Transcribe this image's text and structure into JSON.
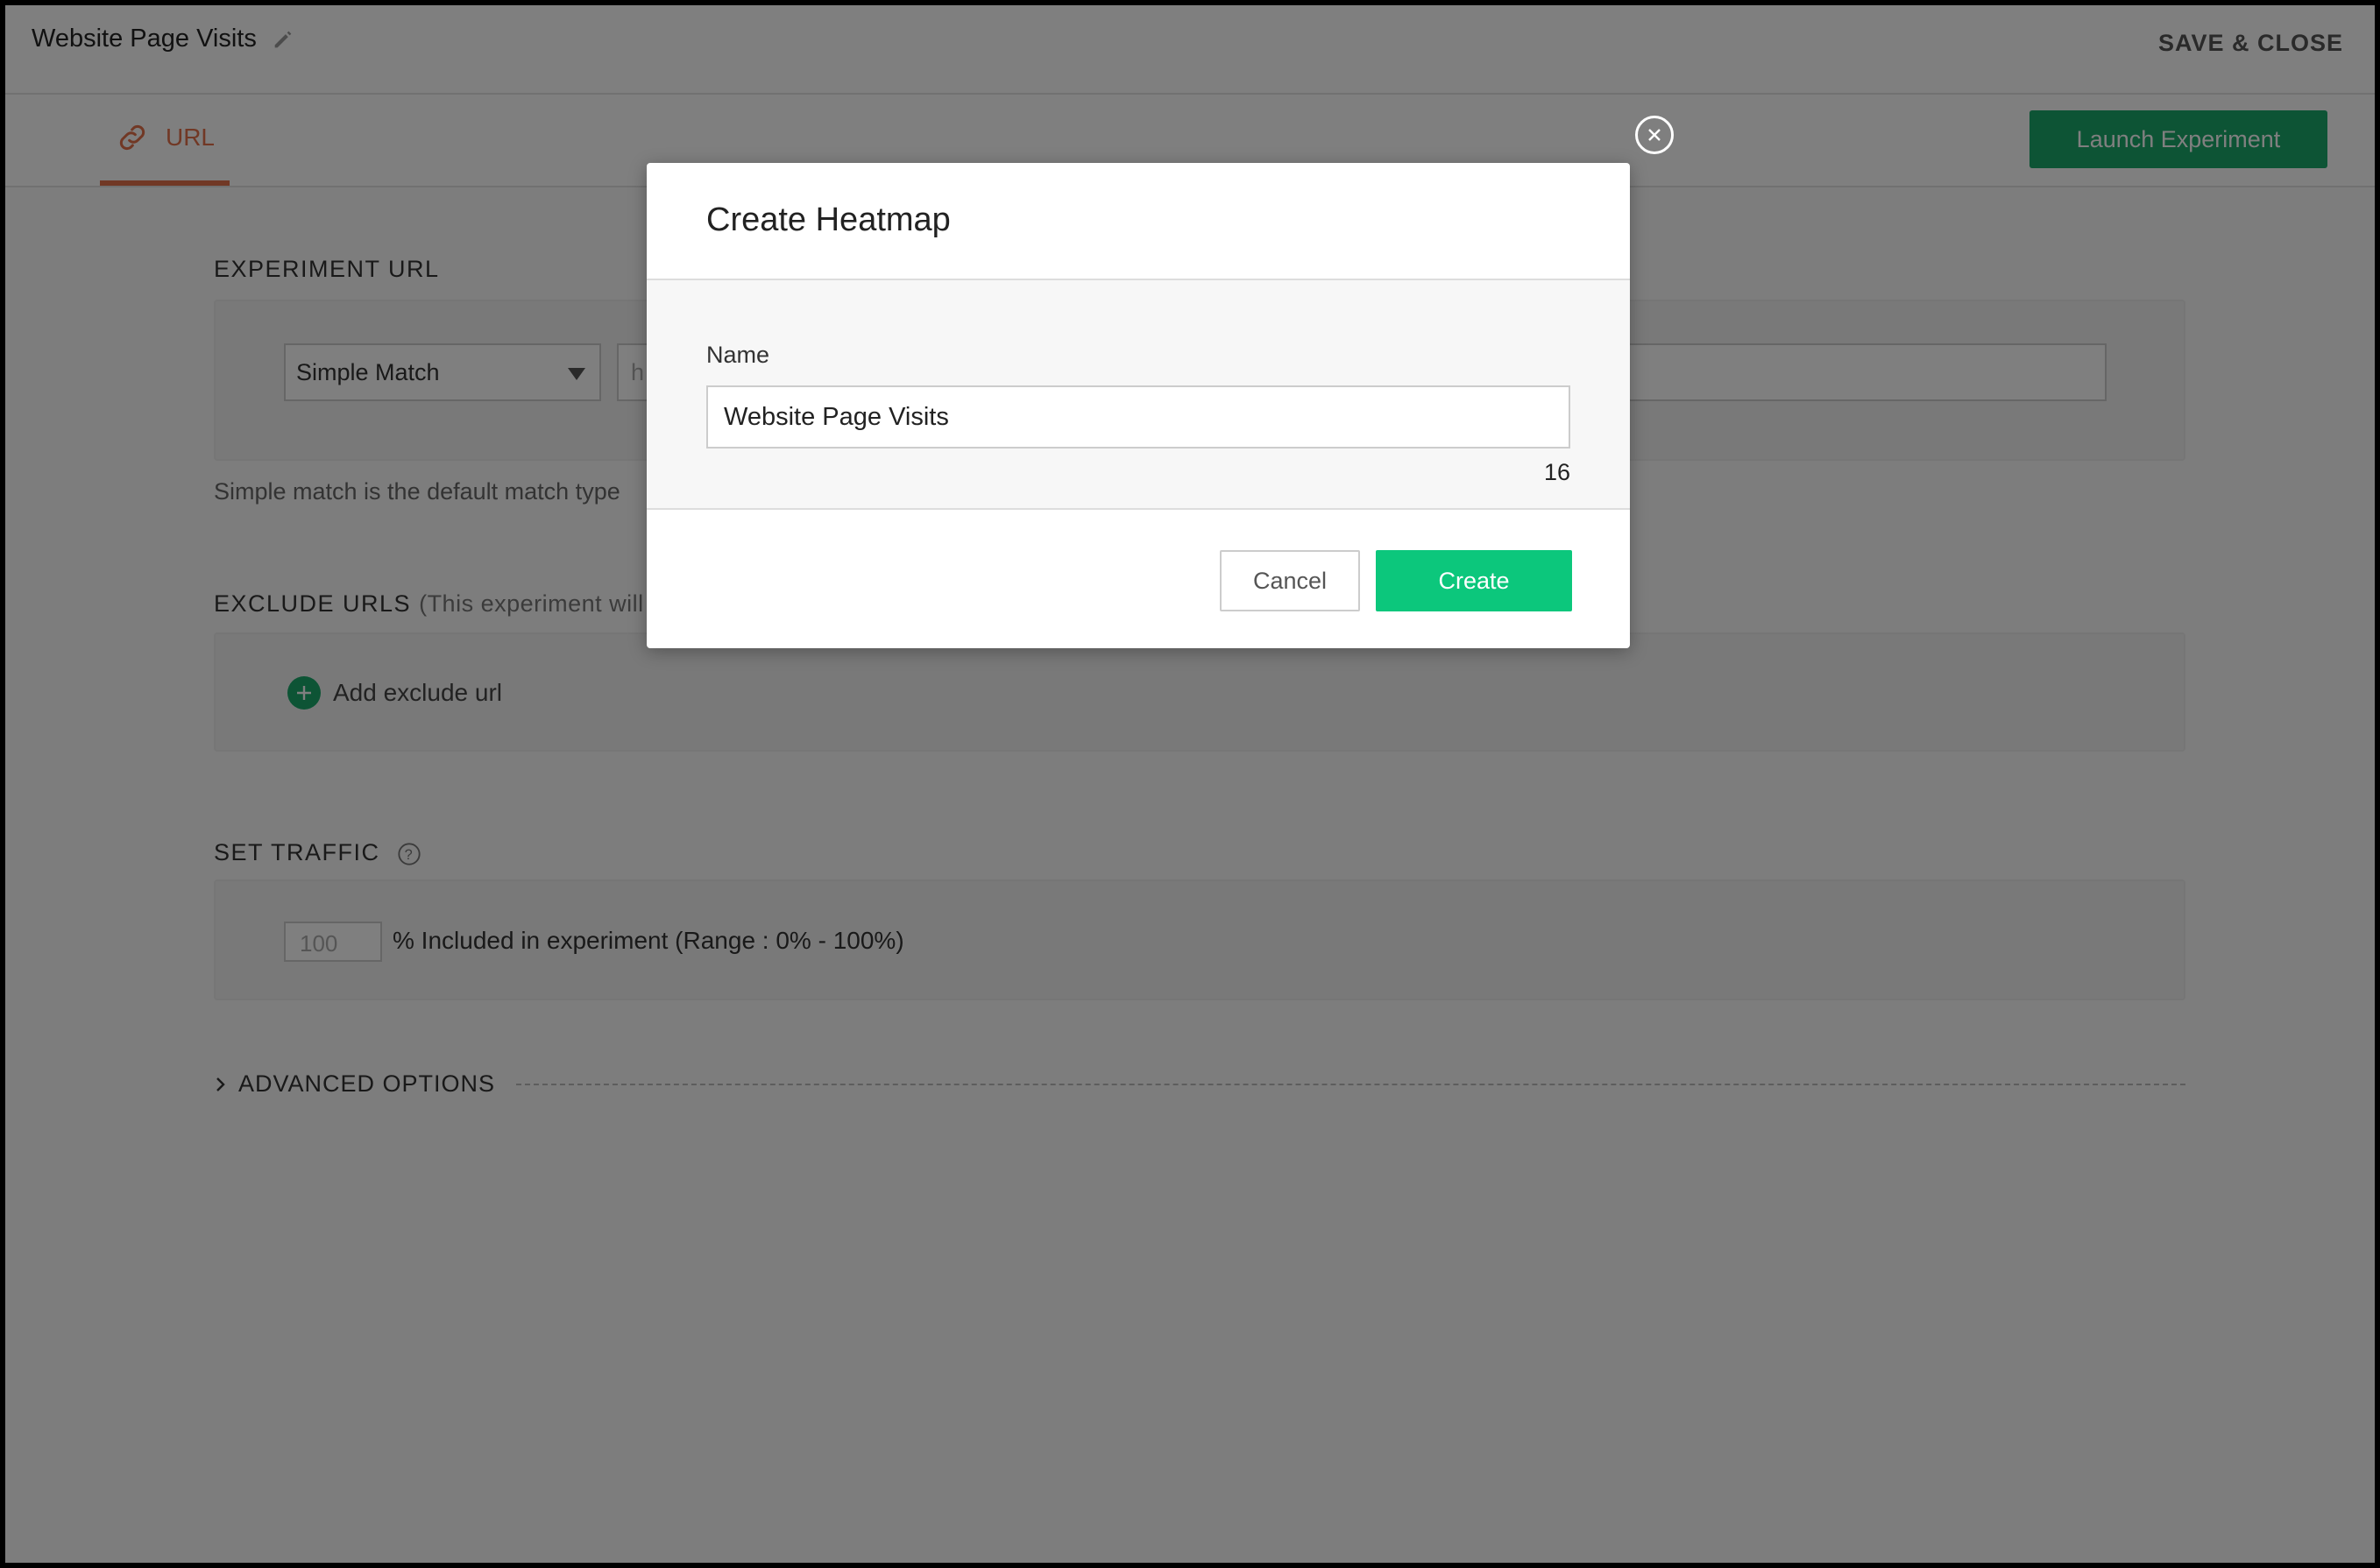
{
  "header": {
    "title": "Website Page Visits",
    "save_close": "SAVE & CLOSE"
  },
  "tabs": {
    "url_label": "URL",
    "launch_label": "Launch Experiment"
  },
  "experiment_url": {
    "label": "EXPERIMENT URL",
    "match_type": "Simple Match",
    "url_placeholder": "h",
    "helper": "Simple match is the default match type"
  },
  "exclude_urls": {
    "label": "EXCLUDE URLS",
    "note": "(This experiment will",
    "add_label": "Add exclude url"
  },
  "traffic": {
    "label": "SET TRAFFIC",
    "value": "100",
    "description": "% Included in experiment (Range : 0% - 100%)"
  },
  "advanced": {
    "label": "ADVANCED OPTIONS"
  },
  "modal": {
    "title": "Create Heatmap",
    "name_label": "Name",
    "name_value": "Website Page Visits",
    "char_count": "16",
    "cancel_label": "Cancel",
    "create_label": "Create"
  },
  "colors": {
    "accent_orange": "#e3704a",
    "primary_green": "#1aa86a",
    "create_green": "#0cc77c"
  }
}
